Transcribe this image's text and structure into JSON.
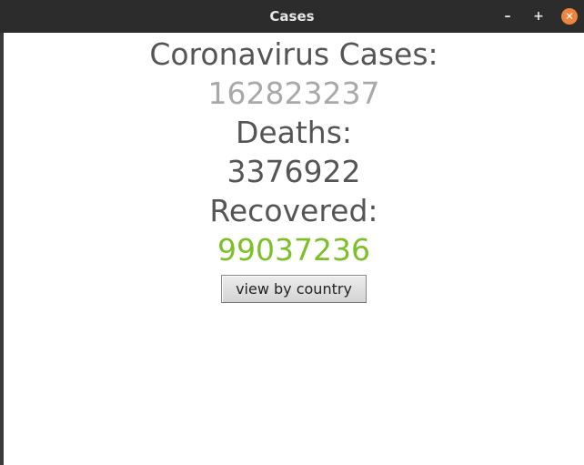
{
  "window": {
    "title": "Cases",
    "minimize_label": "–",
    "maximize_label": "+",
    "close_label": "✕"
  },
  "stats": {
    "cases_label": "Coronavirus Cases:",
    "cases_value": "162823237",
    "deaths_label": "Deaths:",
    "deaths_value": "3376922",
    "recovered_label": "Recovered:",
    "recovered_value": "99037236"
  },
  "actions": {
    "view_by_country_label": "view by country"
  },
  "colors": {
    "cases_value": "#a9a9a9",
    "deaths_value": "#555555",
    "recovered_value": "#7bc028",
    "close_button": "#f0843c"
  }
}
